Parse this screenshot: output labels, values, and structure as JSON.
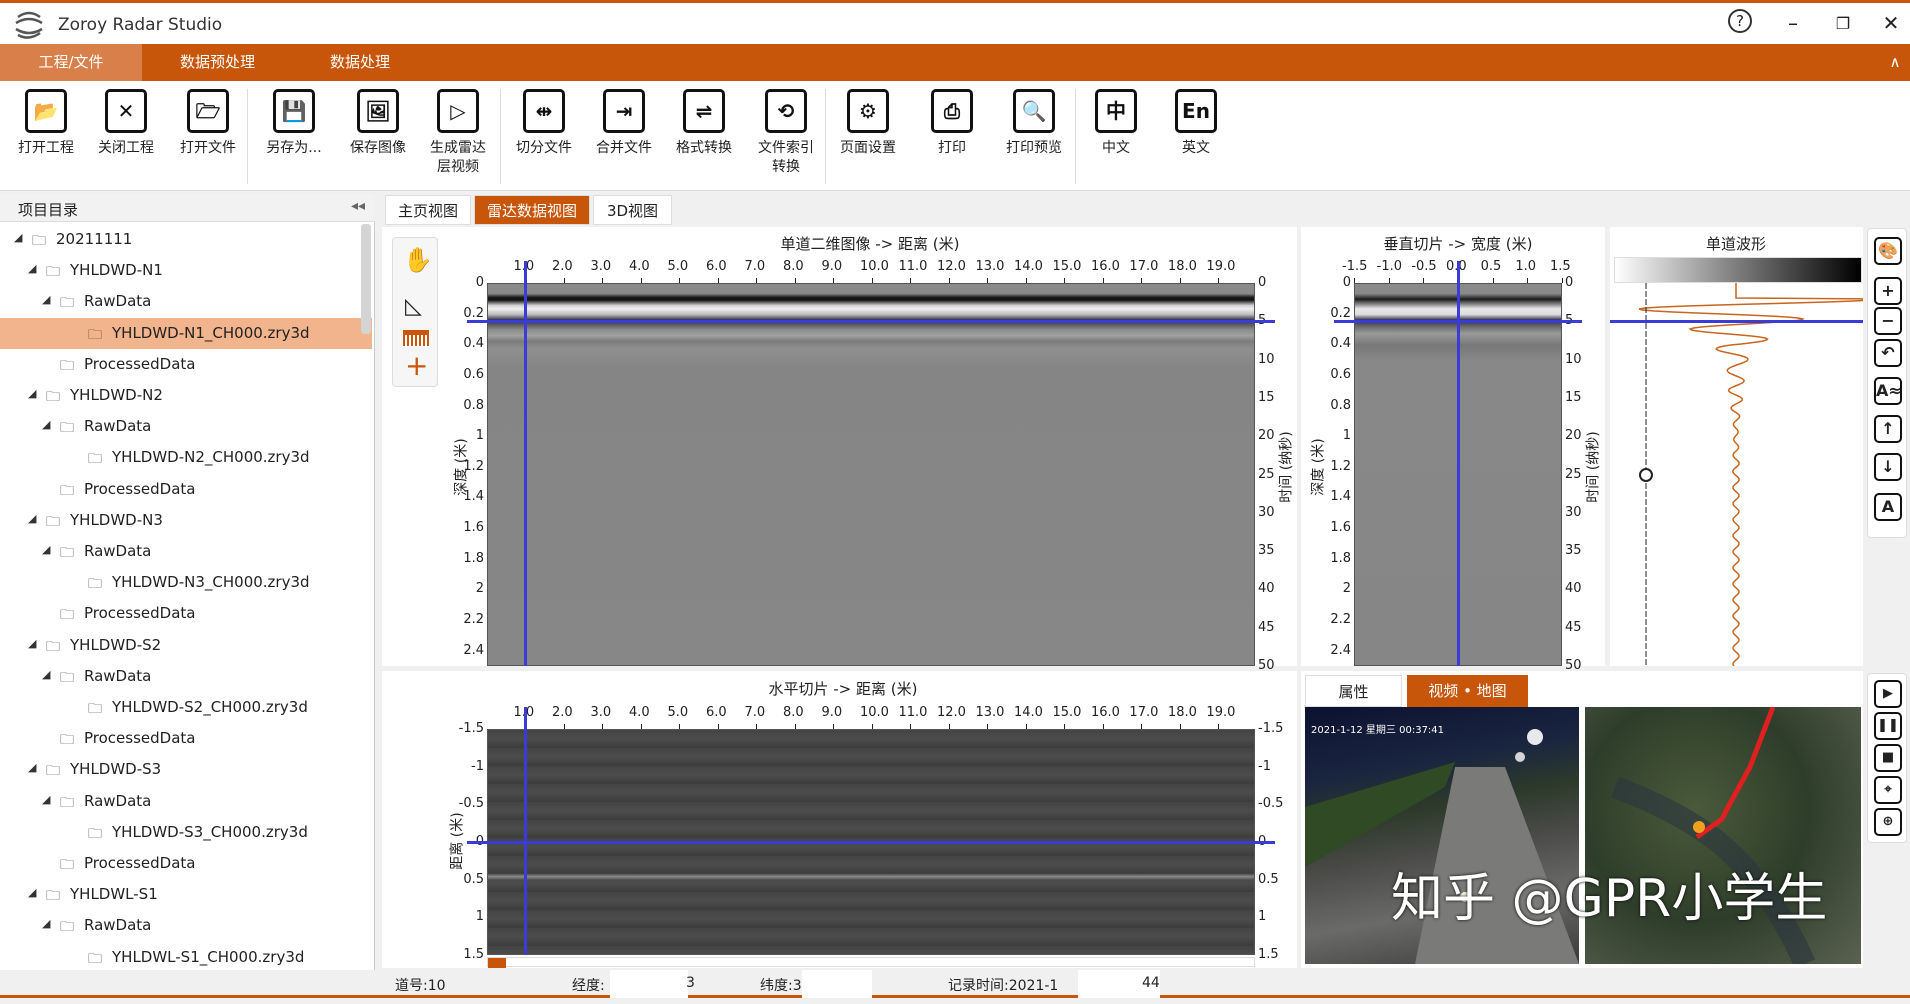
{
  "app": {
    "title": "Zoroy Radar Studio",
    "help": "?",
    "minimize": "–",
    "restore": "❐",
    "close": "✕"
  },
  "ribbon": {
    "tabs": [
      "工程/文件",
      "数据预处理",
      "数据处理"
    ],
    "active": 0,
    "collapse": "∧"
  },
  "toolbar": [
    {
      "label": "打开工程",
      "icon": "open-project-icon",
      "glyph": "📂"
    },
    {
      "label": "关闭工程",
      "icon": "close-project-icon",
      "glyph": "✕"
    },
    {
      "label": "打开文件",
      "icon": "open-file-icon",
      "glyph": "🗁"
    },
    {
      "label": "另存为...",
      "icon": "save-as-icon",
      "glyph": "💾"
    },
    {
      "label": "保存图像",
      "icon": "save-image-icon",
      "glyph": "🖼"
    },
    {
      "label": "生成雷达\n层视频",
      "icon": "radar-video-icon",
      "glyph": "▷"
    },
    {
      "label": "切分文件",
      "icon": "split-file-icon",
      "glyph": "⇹"
    },
    {
      "label": "合并文件",
      "icon": "merge-file-icon",
      "glyph": "⇥"
    },
    {
      "label": "格式转换",
      "icon": "format-convert-icon",
      "glyph": "⇌"
    },
    {
      "label": "文件索引\n转换",
      "icon": "file-index-icon",
      "glyph": "⟲"
    },
    {
      "label": "页面设置",
      "icon": "page-setup-icon",
      "glyph": "⚙"
    },
    {
      "label": "打印",
      "icon": "print-icon",
      "glyph": "⎙"
    },
    {
      "label": "打印预览",
      "icon": "print-preview-icon",
      "glyph": "🔍"
    },
    {
      "label": "中文",
      "icon": "chinese-icon",
      "glyph": "中"
    },
    {
      "label": "英文",
      "icon": "english-icon",
      "glyph": "En"
    }
  ],
  "sidebar": {
    "title": "项目目录",
    "collapse": "◂◂",
    "items": [
      {
        "label": "20211111",
        "level": 0,
        "toggle": true
      },
      {
        "label": "YHLDWD-N1",
        "level": 1,
        "toggle": true
      },
      {
        "label": "RawData",
        "level": 2,
        "toggle": true
      },
      {
        "label": "YHLDWD-N1_CH000.zry3d",
        "level": 3,
        "selected": true
      },
      {
        "label": "ProcessedData",
        "level": 2
      },
      {
        "label": "YHLDWD-N2",
        "level": 1,
        "toggle": true
      },
      {
        "label": "RawData",
        "level": 2,
        "toggle": true
      },
      {
        "label": "YHLDWD-N2_CH000.zry3d",
        "level": 3
      },
      {
        "label": "ProcessedData",
        "level": 2
      },
      {
        "label": "YHLDWD-N3",
        "level": 1,
        "toggle": true
      },
      {
        "label": "RawData",
        "level": 2,
        "toggle": true
      },
      {
        "label": "YHLDWD-N3_CH000.zry3d",
        "level": 3
      },
      {
        "label": "ProcessedData",
        "level": 2
      },
      {
        "label": "YHLDWD-S2",
        "level": 1,
        "toggle": true
      },
      {
        "label": "RawData",
        "level": 2,
        "toggle": true
      },
      {
        "label": "YHLDWD-S2_CH000.zry3d",
        "level": 3
      },
      {
        "label": "ProcessedData",
        "level": 2
      },
      {
        "label": "YHLDWD-S3",
        "level": 1,
        "toggle": true
      },
      {
        "label": "RawData",
        "level": 2,
        "toggle": true
      },
      {
        "label": "YHLDWD-S3_CH000.zry3d",
        "level": 3
      },
      {
        "label": "ProcessedData",
        "level": 2
      },
      {
        "label": "YHLDWL-S1",
        "level": 1,
        "toggle": true
      },
      {
        "label": "RawData",
        "level": 2,
        "toggle": true
      },
      {
        "label": "YHLDWL-S1_CH000.zry3d",
        "level": 3
      },
      {
        "label": "ProcessedData",
        "level": 2
      }
    ]
  },
  "view_tabs": [
    "主页视图",
    "雷达数据视图",
    "3D视图"
  ],
  "view_tab_active": 1,
  "main_view": {
    "title": "单道二维图像 -> 距离 (米)",
    "ylabel_left": "深度 (米)",
    "ylabel_right": "时间 (纳秒)",
    "x_ticks": [
      "1.0",
      "2.0",
      "3.0",
      "4.0",
      "5.0",
      "6.0",
      "7.0",
      "8.0",
      "9.0",
      "10.0",
      "11.0",
      "12.0",
      "13.0",
      "14.0",
      "15.0",
      "16.0",
      "17.0",
      "18.0",
      "19.0"
    ],
    "x_range": [
      0,
      19.95
    ],
    "depth_ticks": [
      "0",
      "0.2",
      "0.4",
      "0.6",
      "0.8",
      "1",
      "1.2",
      "1.4",
      "1.6",
      "1.8",
      "2",
      "2.2",
      "2.4"
    ],
    "depth_range": [
      0,
      2.5
    ],
    "time_ticks": [
      "0",
      "5",
      "10",
      "15",
      "20",
      "25",
      "30",
      "35",
      "40",
      "45",
      "50"
    ],
    "time_range": [
      0,
      50
    ],
    "cursor": {
      "x": 1.0,
      "time": 5
    }
  },
  "vertical_slice": {
    "title": "垂直切片 -> 宽度 (米)",
    "ylabel_left": "深度 (米)",
    "ylabel_right": "时间 (纳秒)",
    "x_ticks": [
      "-1.5",
      "-1.0",
      "-0.5",
      "0.0",
      "0.5",
      "1.0",
      "1.5"
    ],
    "x_range": [
      -1.5,
      1.5
    ],
    "cursor": {
      "x": 0.0,
      "time": 5
    }
  },
  "waveform": {
    "title": "单道波形"
  },
  "right_tools": [
    "palette-icon",
    "zoom-in-icon",
    "zoom-out-icon",
    "undo-icon",
    "auto-gain-icon",
    "move-up-icon",
    "move-down-icon",
    "text-annotation-icon"
  ],
  "right_tool_glyphs": [
    "🎨",
    "+",
    "−",
    "↶",
    "A≈",
    "↑",
    "↓",
    "A"
  ],
  "horizontal_slice": {
    "title": "水平切片 -> 距离 (米)",
    "ylabel": "距离 (米)",
    "x_ticks": [
      "1.0",
      "2.0",
      "3.0",
      "4.0",
      "5.0",
      "6.0",
      "7.0",
      "8.0",
      "9.0",
      "10.0",
      "11.0",
      "12.0",
      "13.0",
      "14.0",
      "15.0",
      "16.0",
      "17.0",
      "18.0",
      "19.0"
    ],
    "x_range": [
      0,
      19.95
    ],
    "y_ticks": [
      "-1.5",
      "-1",
      "-0.5",
      "0",
      "0.5",
      "1",
      "1.5"
    ],
    "y_range": [
      -1.5,
      1.5
    ],
    "cursor": {
      "x": 1.0,
      "y": 0
    },
    "progress": 0.0
  },
  "media": {
    "tabs": [
      "属性",
      "视频 • 地图"
    ],
    "active": 1,
    "video_timestamp": "2021-1-12 星期三 00:37:41",
    "watermark": "知乎 @GPR小学生"
  },
  "player_tools": [
    "play-icon",
    "pause-icon",
    "stop-icon",
    "video-location-icon",
    "map-location-icon"
  ],
  "player_glyphs": [
    "▶",
    "❚❚",
    "■",
    "⌖",
    "⊕"
  ],
  "status": {
    "trace": "道号:10",
    "lon_label": "经度:",
    "lon_tail": "3",
    "lat_label": "纬度:3",
    "time_label": "记录时间:2021-1",
    "time_tail": "44"
  },
  "colors": {
    "accent": "#c8560a",
    "cursor": "#3b3bd6",
    "waveform": "#c8651e",
    "route": "#e02020"
  }
}
